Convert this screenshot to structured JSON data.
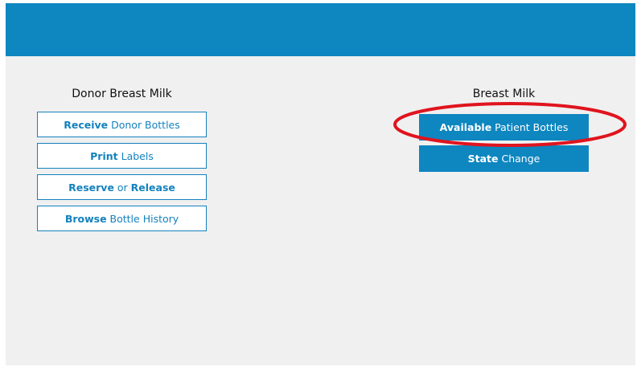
{
  "left_section": {
    "title": "Donor Breast Milk",
    "buttons": [
      {
        "bold": "Receive",
        "rest": " Donor Bottles"
      },
      {
        "bold": "Print",
        "rest": " Labels"
      },
      {
        "bold": "Reserve",
        "middle": " or ",
        "bold2": "Release"
      },
      {
        "bold": "Browse",
        "rest": " Bottle History"
      }
    ]
  },
  "right_section": {
    "title": "Breast Milk",
    "buttons": [
      {
        "bold": "Available",
        "rest": " Patient Bottles"
      },
      {
        "bold": "State",
        "rest": " Change"
      }
    ]
  },
  "colors": {
    "accent": "#0e86c0",
    "background": "#f0f0f0",
    "highlight": "#e0141e"
  }
}
